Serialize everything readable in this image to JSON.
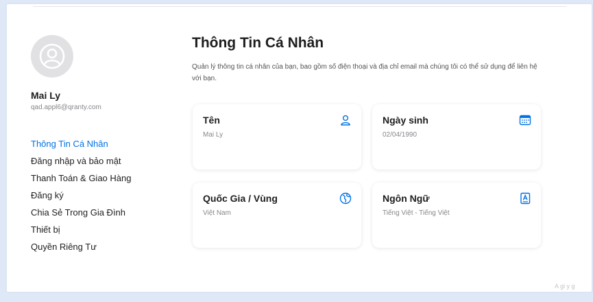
{
  "user": {
    "name": "Mai Ly",
    "email": "qad.appl6@qranty.com"
  },
  "sidebar": {
    "items": [
      {
        "label": "Thông Tin Cá Nhân",
        "active": true
      },
      {
        "label": "Đăng nhập và bảo mật",
        "active": false
      },
      {
        "label": "Thanh Toán & Giao Hàng",
        "active": false
      },
      {
        "label": "Đăng ký",
        "active": false
      },
      {
        "label": "Chia Sẻ Trong Gia Đình",
        "active": false
      },
      {
        "label": "Thiết bị",
        "active": false
      },
      {
        "label": "Quyền Riêng Tư",
        "active": false
      }
    ]
  },
  "main": {
    "title": "Thông Tin Cá Nhân",
    "description": "Quản lý thông tin cá nhân của bạn, bao gồm số điện thoại và địa chỉ email mà chúng tôi có thể sử dụng để liên hệ với bạn.",
    "cards": [
      {
        "title": "Tên",
        "value": "Mai Ly",
        "icon": "person-icon"
      },
      {
        "title": "Ngày sinh",
        "value": "02/04/1990",
        "icon": "calendar-icon"
      },
      {
        "title": "Quốc Gia / Vùng",
        "value": "Việt Nam",
        "icon": "globe-icon"
      },
      {
        "title": "Ngôn Ngữ",
        "value": "Tiếng Việt - Tiếng Việt",
        "icon": "language-book-icon"
      }
    ]
  },
  "corner_text": "A gi y g",
  "colors": {
    "accent": "#0071e3",
    "avatar_bg": "#e1e1e4",
    "backdrop": "#dfe8f7"
  }
}
